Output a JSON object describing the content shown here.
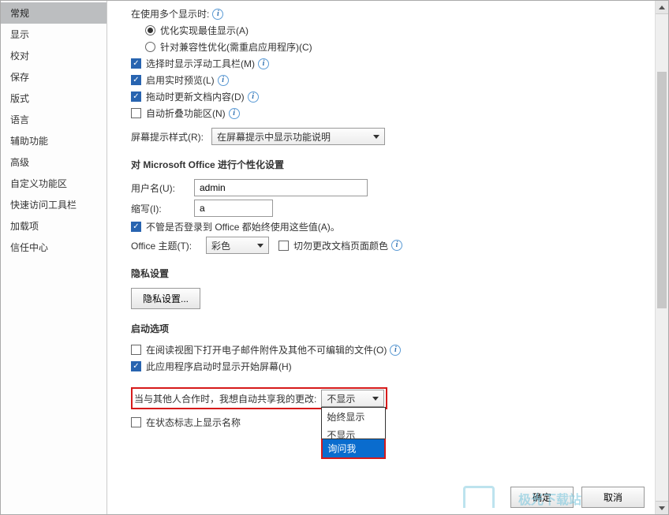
{
  "sidebar": {
    "items": [
      {
        "label": "常规",
        "selected": true
      },
      {
        "label": "显示"
      },
      {
        "label": "校对"
      },
      {
        "label": "保存"
      },
      {
        "label": "版式"
      },
      {
        "label": "语言"
      },
      {
        "label": "辅助功能"
      },
      {
        "label": "高级"
      },
      {
        "label": "自定义功能区"
      },
      {
        "label": "快速访问工具栏"
      },
      {
        "label": "加载项"
      },
      {
        "label": "信任中心"
      }
    ]
  },
  "multi_display": {
    "header": "在使用多个显示时:",
    "opt1": "优化实现最佳显示(A)",
    "opt2": "针对兼容性优化(需重启应用程序)(C)"
  },
  "general_opts": {
    "floating_toolbar": "选择时显示浮动工具栏(M)",
    "live_preview": "启用实时预览(L)",
    "drag_update": "拖动时更新文档内容(D)",
    "collapse_ribbon": "自动折叠功能区(N)"
  },
  "screentip": {
    "label": "屏幕提示样式(R):",
    "value": "在屏幕提示中显示功能说明"
  },
  "personalize": {
    "title": "对 Microsoft Office 进行个性化设置",
    "username_label": "用户名(U):",
    "username_value": "admin",
    "initials_label": "缩写(I):",
    "initials_value": "a",
    "always_use": "不管是否登录到 Office 都始终使用这些值(A)。",
    "theme_label": "Office 主题(T):",
    "theme_value": "彩色",
    "no_change_bg": "切勿更改文档页面颜色"
  },
  "privacy": {
    "title": "隐私设置",
    "button": "隐私设置..."
  },
  "startup": {
    "title": "启动选项",
    "open_attachments": "在阅读视图下打开电子邮件附件及其他不可编辑的文件(O)",
    "show_start": "此应用程序启动时显示开始屏幕(H)",
    "collab_label": "当与其他人合作时，我想自动共享我的更改:",
    "collab_value": "不显示",
    "collab_options": [
      "始终显示",
      "不显示",
      "询问我"
    ],
    "show_status": "在状态标志上显示名称"
  },
  "footer": {
    "ok": "确定",
    "cancel": "取消"
  },
  "watermark": "极光下载站"
}
